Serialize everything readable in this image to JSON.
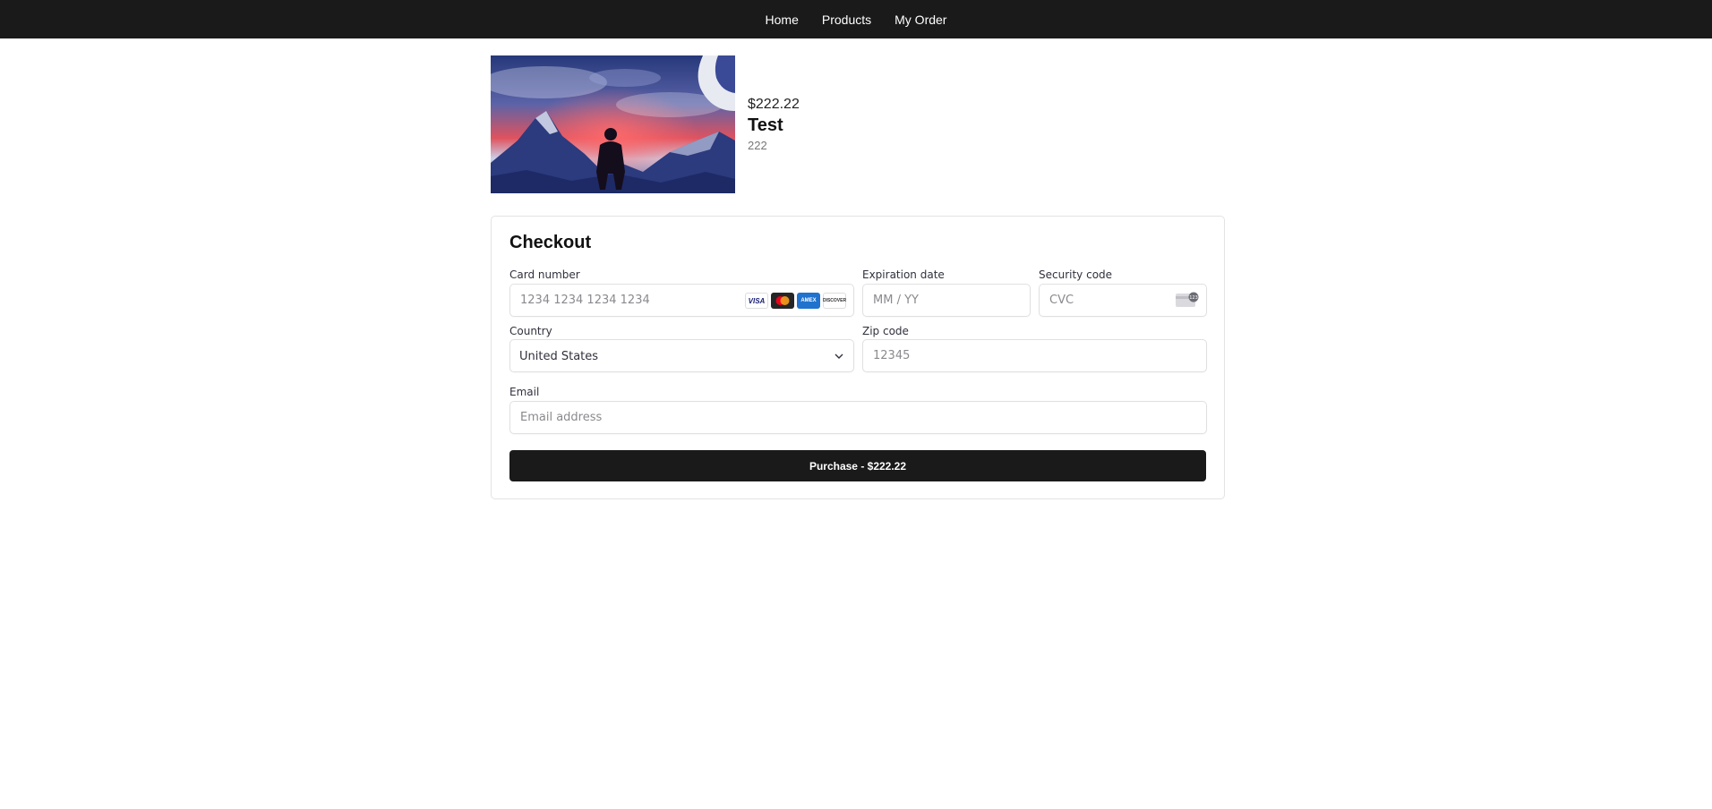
{
  "nav": {
    "items": [
      "Home",
      "Products",
      "My Order"
    ]
  },
  "product": {
    "image_alt": "Person standing before mountains under a red and blue sky",
    "price": "$222.22",
    "title": "Test",
    "description": "222"
  },
  "checkout": {
    "heading": "Checkout",
    "card_number": {
      "label": "Card number",
      "placeholder": "1234 1234 1234 1234",
      "brands": [
        "VISA",
        "mastercard",
        "AMEX",
        "DISCOVER"
      ]
    },
    "expiration": {
      "label": "Expiration date",
      "placeholder": "MM / YY"
    },
    "security": {
      "label": "Security code",
      "placeholder": "CVC"
    },
    "country": {
      "label": "Country",
      "value": "United States"
    },
    "zip": {
      "label": "Zip code",
      "placeholder": "12345"
    },
    "email": {
      "label": "Email",
      "placeholder": "Email address"
    },
    "purchase_label": "Purchase - $222.22"
  }
}
